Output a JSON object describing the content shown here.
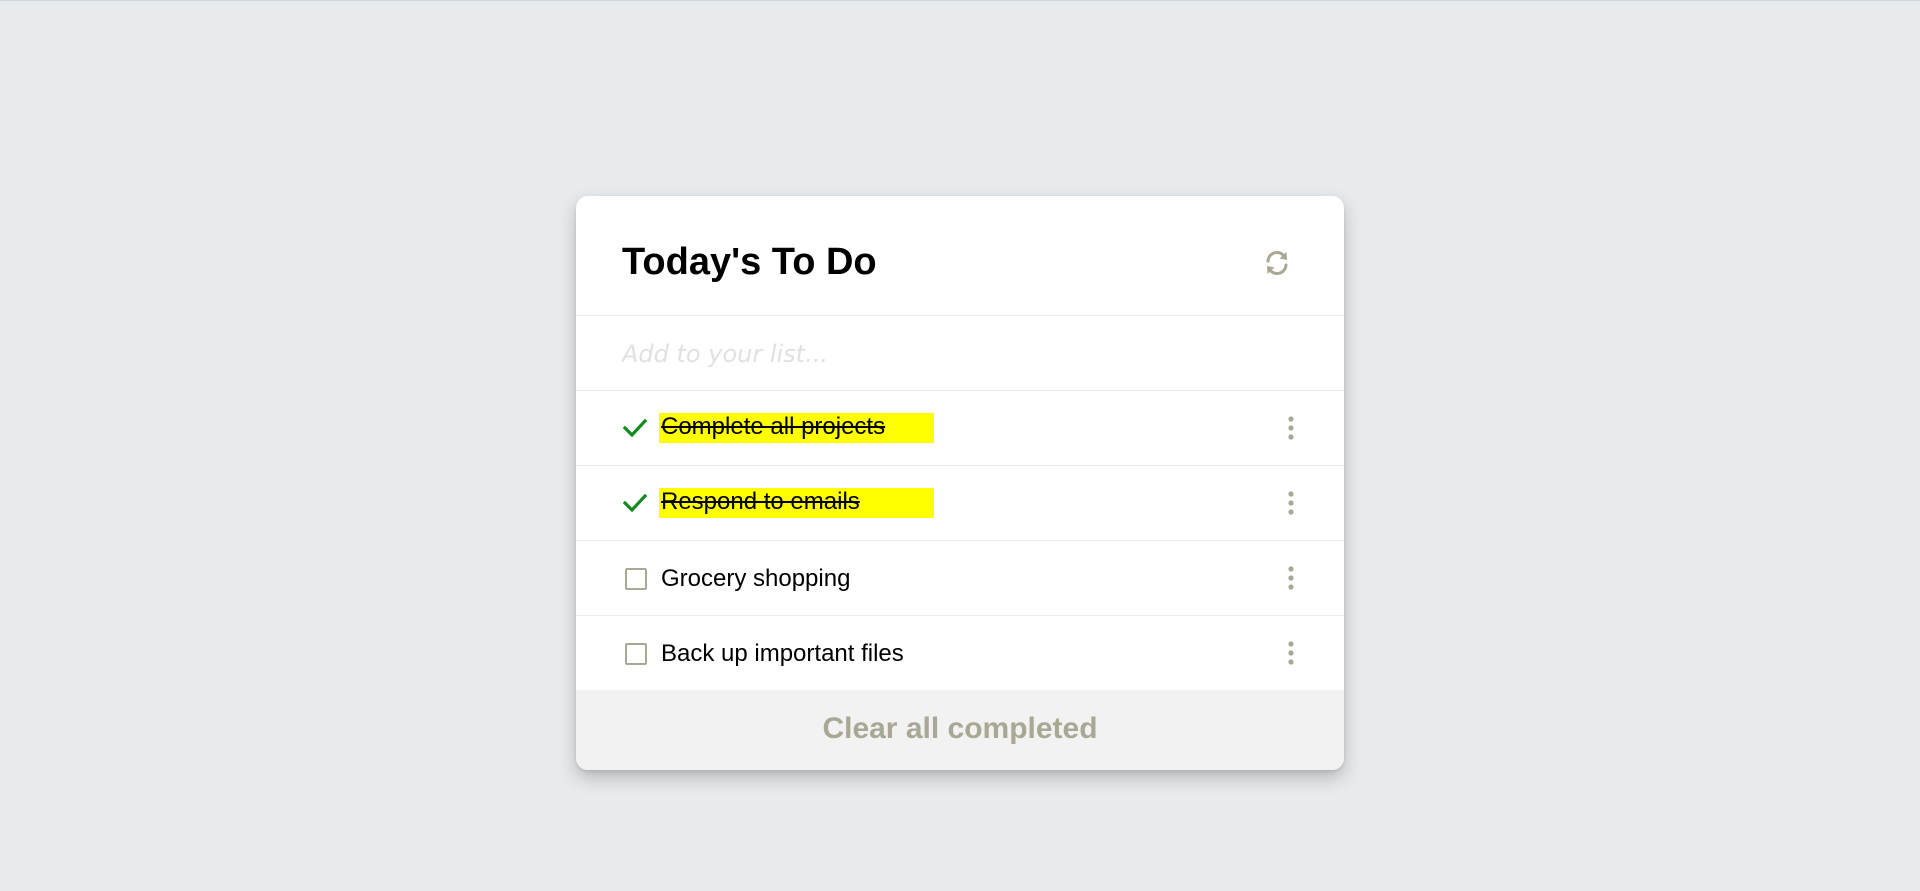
{
  "app": {
    "title": "Today's To Do",
    "refresh_icon": "refresh-icon"
  },
  "add": {
    "placeholder": "Add to your list...",
    "value": ""
  },
  "todos": [
    {
      "label": "Complete all projects",
      "completed": true
    },
    {
      "label": "Respond to emails",
      "completed": true
    },
    {
      "label": "Grocery shopping",
      "completed": false
    },
    {
      "label": "Back up important files",
      "completed": false
    }
  ],
  "footer": {
    "clear_label": "Clear all completed"
  },
  "colors": {
    "background": "#e8ebee",
    "card": "#ffffff",
    "highlight": "#ffff00",
    "check": "#138a1e",
    "muted_icon": "#a8a894",
    "footer_bg": "#f3f2f2"
  }
}
